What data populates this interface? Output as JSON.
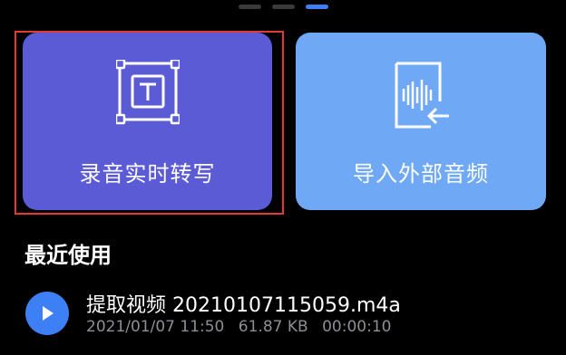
{
  "pager": {
    "count": 3,
    "active_index": 2
  },
  "cards": {
    "realtime": {
      "label": "录音实时转写",
      "icon": "text-box-icon",
      "color": "#5b5bd6",
      "selected": true
    },
    "import": {
      "label": "导入外部音频",
      "icon": "audio-file-import-icon",
      "color": "#6fa9f5"
    }
  },
  "recent": {
    "title": "最近使用",
    "items": [
      {
        "name": "提取视频 20210107115059.m4a",
        "date": "2021/01/07 11:50",
        "size": "61.87 KB",
        "duration": "00:00:10",
        "icon": "play-icon"
      }
    ]
  },
  "colors": {
    "background": "#000000",
    "accent": "#3d7ff5",
    "highlight": "#e53935",
    "meta_text": "#8e8e93"
  }
}
